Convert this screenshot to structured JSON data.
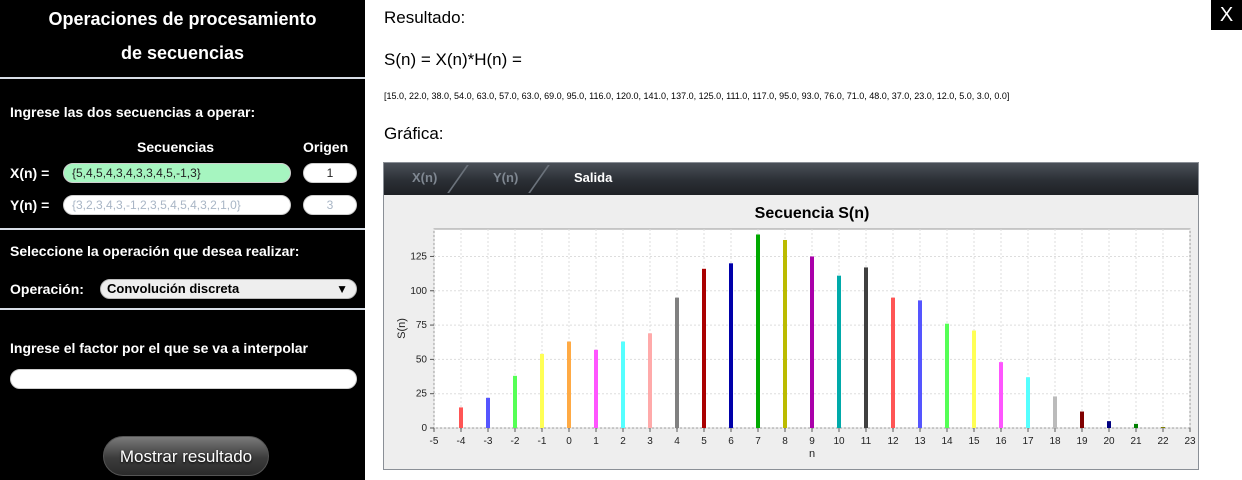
{
  "sidebar": {
    "title_line1": "Operaciones de procesamiento",
    "title_line2": "de secuencias",
    "prompt_sequences": "Ingrese las dos secuencias a operar:",
    "col_sequences": "Secuencias",
    "col_origin": "Origen",
    "x_label": "X(n) =",
    "x_value": "{5,4,5,4,3,4,3,3,4,5,-1,3}",
    "x_origin": "1",
    "y_label": "Y(n) =",
    "y_placeholder": "{3,2,3,4,3,-1,2,3,5,4,5,4,3,2,1,0}",
    "y_origin_placeholder": "3",
    "prompt_operation": "Seleccione la operación que desea realizar:",
    "operation_label": "Operación:",
    "operation_value": "Convolución discreta",
    "prompt_interpolate": "Ingrese el factor por el que se va a interpolar",
    "interpolate_value": "",
    "show_button": "Mostrar resultado"
  },
  "main": {
    "result_label": "Resultado:",
    "formula": "S(n) =  X(n)*H(n) =",
    "result_values": "[15.0, 22.0, 38.0, 54.0, 63.0, 57.0, 63.0, 69.0, 95.0, 116.0, 120.0, 141.0, 137.0, 125.0, 111.0, 117.0, 95.0, 93.0, 76.0, 71.0, 48.0, 37.0, 23.0, 12.0, 5.0, 3.0, 0.0]",
    "graph_label": "Gráfica:",
    "close_label": "X"
  },
  "tabs": [
    {
      "label": "X(n)"
    },
    {
      "label": "Y(n)"
    },
    {
      "label": "Salida"
    }
  ],
  "chart_data": {
    "type": "bar",
    "title": "Secuencia S(n)",
    "xlabel": "n",
    "ylabel": "S(n)",
    "xlim": [
      -5,
      23
    ],
    "ylim": [
      0,
      145
    ],
    "x_ticks": [
      -5,
      -4,
      -3,
      -2,
      -1,
      0,
      1,
      2,
      3,
      4,
      5,
      6,
      7,
      8,
      9,
      10,
      11,
      12,
      13,
      14,
      15,
      16,
      17,
      18,
      19,
      20,
      21,
      22,
      23
    ],
    "y_ticks": [
      0,
      25,
      50,
      75,
      100,
      125
    ],
    "grid": true,
    "x": [
      -4,
      -3,
      -2,
      -1,
      0,
      1,
      2,
      3,
      4,
      5,
      6,
      7,
      8,
      9,
      10,
      11,
      12,
      13,
      14,
      15,
      16,
      17,
      18,
      19,
      20,
      21,
      22
    ],
    "values": [
      15,
      22,
      38,
      54,
      63,
      57,
      63,
      69,
      95,
      116,
      120,
      141,
      137,
      125,
      111,
      117,
      95,
      93,
      76,
      71,
      48,
      37,
      23,
      12,
      5,
      3,
      0
    ],
    "colors": [
      "#ff5555",
      "#5555ff",
      "#55ff55",
      "#ffff55",
      "#ffaa44",
      "#ff55ff",
      "#55ffff",
      "#ffaaaa",
      "#808080",
      "#aa0000",
      "#0000aa",
      "#00aa00",
      "#bbbb00",
      "#aa00aa",
      "#00aaaa",
      "#404040",
      "#ff5555",
      "#5555ff",
      "#55ff55",
      "#ffff55",
      "#ff55ff",
      "#55ffff",
      "#bbbbbb",
      "#800000",
      "#000080",
      "#008000",
      "#808000"
    ]
  }
}
